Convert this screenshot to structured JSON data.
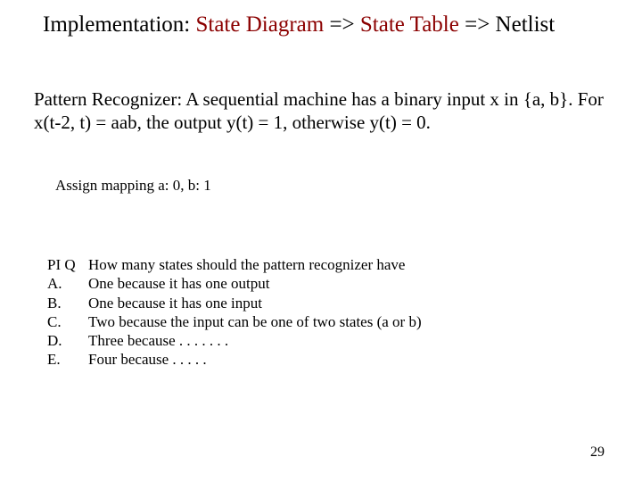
{
  "title": {
    "part1": "Implementation: ",
    "part2_red": "State Diagram",
    "part3": " => ",
    "part4_red": "State Table",
    "part5": " => Netlist"
  },
  "body_text": "Pattern Recognizer: A sequential machine has a binary input x in {a, b}. For x(t-2, t) = aab, the output y(t) = 1, otherwise y(t) = 0.",
  "mapping": "Assign mapping a: 0, b: 1",
  "question": {
    "prompt_label": "PI Q",
    "prompt_text": "How many states should the pattern recognizer have",
    "options": [
      {
        "label": "A.",
        "text": "One because it has one output"
      },
      {
        "label": "B.",
        "text": "One because it has one input"
      },
      {
        "label": "C.",
        "text": "Two because the input can be one of two states (a or b)"
      },
      {
        "label": "D.",
        "text": "Three because . . . . . . ."
      },
      {
        "label": "E.",
        "text": "Four because . . . . ."
      }
    ]
  },
  "page_number": "29"
}
